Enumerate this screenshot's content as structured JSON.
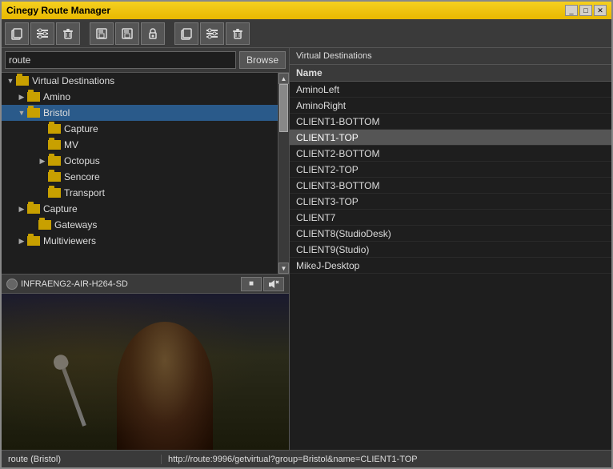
{
  "window": {
    "title": "Cinegy Route Manager",
    "controls": [
      "_",
      "□",
      "✕"
    ]
  },
  "toolbar": {
    "left_buttons": [
      "📋",
      "🔧",
      "🗑"
    ],
    "mid_buttons": [
      "💾",
      "💾",
      "🔒"
    ],
    "right_buttons": [
      "📋",
      "🔧",
      "🗑"
    ]
  },
  "search": {
    "value": "route",
    "browse_label": "Browse"
  },
  "tree": {
    "root_label": "Virtual Destinations",
    "items": [
      {
        "label": "Amino",
        "level": 1,
        "expanded": false,
        "selected": false
      },
      {
        "label": "Bristol",
        "level": 1,
        "expanded": true,
        "selected": true
      },
      {
        "label": "Capture",
        "level": 2,
        "expanded": false,
        "selected": false
      },
      {
        "label": "MV",
        "level": 2,
        "expanded": false,
        "selected": false
      },
      {
        "label": "Octopus",
        "level": 2,
        "expanded": false,
        "selected": false
      },
      {
        "label": "Sencore",
        "level": 2,
        "expanded": false,
        "selected": false
      },
      {
        "label": "Transport",
        "level": 2,
        "expanded": false,
        "selected": false
      },
      {
        "label": "Capture",
        "level": 1,
        "expanded": false,
        "selected": false
      },
      {
        "label": "Gateways",
        "level": 1,
        "expanded": false,
        "selected": false
      },
      {
        "label": "Multiviewers",
        "level": 1,
        "expanded": false,
        "selected": false
      }
    ]
  },
  "preview": {
    "stream_name": "INFRAENG2-AIR-H264-SD",
    "stop_label": "■",
    "audio_label": "🔇"
  },
  "virtual_destinations": {
    "panel_label": "Virtual Destinations",
    "column_header": "Name",
    "items": [
      {
        "label": "AminoLeft",
        "selected": false
      },
      {
        "label": "AminoRight",
        "selected": false
      },
      {
        "label": "CLIENT1-BOTTOM",
        "selected": false
      },
      {
        "label": "CLIENT1-TOP",
        "selected": true
      },
      {
        "label": "CLIENT2-BOTTOM",
        "selected": false
      },
      {
        "label": "CLIENT2-TOP",
        "selected": false
      },
      {
        "label": "CLIENT3-BOTTOM",
        "selected": false
      },
      {
        "label": "CLIENT3-TOP",
        "selected": false
      },
      {
        "label": "CLIENT7",
        "selected": false
      },
      {
        "label": "CLIENT8(StudioDesk)",
        "selected": false
      },
      {
        "label": "CLIENT9(Studio)",
        "selected": false
      },
      {
        "label": "MikeJ-Desktop",
        "selected": false
      }
    ]
  },
  "status": {
    "left": "route (Bristol)",
    "right": "http://route:9996/getvirtual?group=Bristol&name=CLIENT1-TOP"
  }
}
